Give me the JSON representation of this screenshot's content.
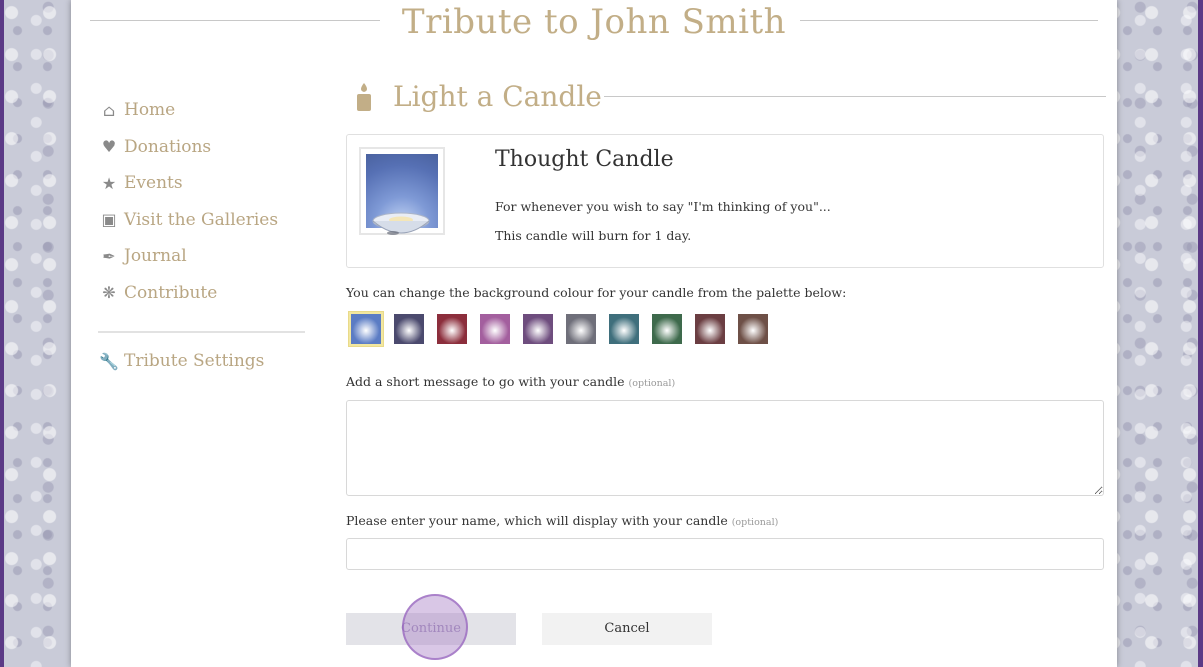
{
  "page": {
    "title": "Tribute to John Smith"
  },
  "nav": {
    "items": [
      {
        "label": "Home",
        "icon": "home-icon"
      },
      {
        "label": "Donations",
        "icon": "heart-icon"
      },
      {
        "label": "Events",
        "icon": "star-icon"
      },
      {
        "label": "Visit the Galleries",
        "icon": "gallery-icon"
      },
      {
        "label": "Journal",
        "icon": "quill-icon"
      },
      {
        "label": "Contribute",
        "icon": "puzzle-icon"
      }
    ],
    "settings": {
      "label": "Tribute Settings",
      "icon": "wrench-icon"
    }
  },
  "section": {
    "title": "Light a Candle",
    "icon": "candle-icon"
  },
  "candle": {
    "name": "Thought Candle",
    "description": "For whenever you wish to say \"I'm thinking of you\"...",
    "duration": "This candle will burn for 1 day."
  },
  "palette": {
    "label": "You can change the background colour for your candle from the palette below:",
    "selected_index": 0,
    "swatches": [
      "#5b7cc4",
      "#4b4a6e",
      "#8c2e3c",
      "#a35f9e",
      "#6e4d7e",
      "#6f6f7a",
      "#3f6f7c",
      "#3e6a4c",
      "#6b3e42",
      "#6e5047"
    ]
  },
  "message": {
    "label": "Add a short message to go with your candle",
    "optional": "(optional)",
    "value": ""
  },
  "name_field": {
    "label": "Please enter your name, which will display with your candle",
    "optional": "(optional)",
    "value": ""
  },
  "buttons": {
    "continue": "Continue",
    "cancel": "Cancel"
  },
  "colors": {
    "accent_gold": "#c2ae87",
    "frame_purple": "#5b3a86"
  }
}
